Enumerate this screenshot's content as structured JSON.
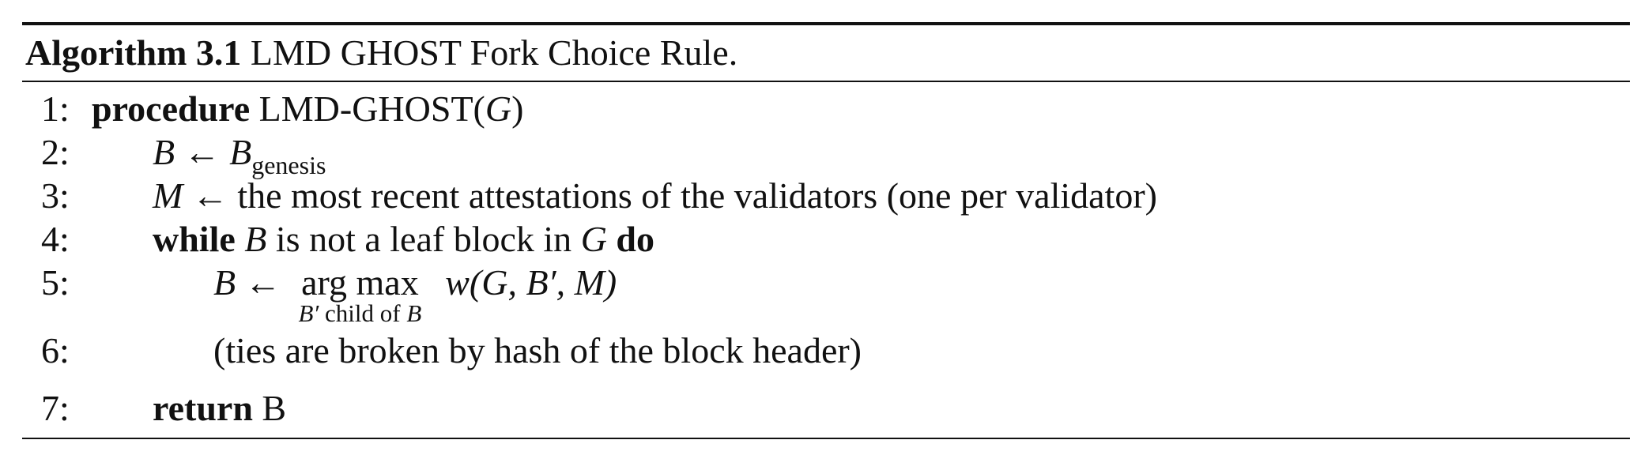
{
  "caption": {
    "label": "Algorithm 3.1",
    "title": "LMD GHOST Fork Choice Rule."
  },
  "lines": [
    {
      "num": "1:",
      "kw": "procedure",
      "text": "LMD-GHOST(",
      "var": "G",
      "close": ")"
    },
    {
      "num": "2:",
      "lhs": "B",
      "arrow": "←",
      "rhs": "B",
      "sub": "genesis"
    },
    {
      "num": "3:",
      "lhs": "M",
      "arrow": "←",
      "text": "the most recent attestations of the validators (one per validator)"
    },
    {
      "num": "4:",
      "kw": "while",
      "var1": "B",
      "text": "is not a leaf block in",
      "var2": "G",
      "kw2": "do"
    },
    {
      "num": "5:",
      "lhs": "B",
      "arrow": "←",
      "op": "arg max",
      "under_var": "B′",
      "under_text": "child of",
      "under_var2": "B",
      "expr": "w(G, B′, M)"
    },
    {
      "num": "6:",
      "text": "(ties are broken by hash of the block header)"
    },
    {
      "num": "7:",
      "kw": "return",
      "text": "B"
    }
  ]
}
